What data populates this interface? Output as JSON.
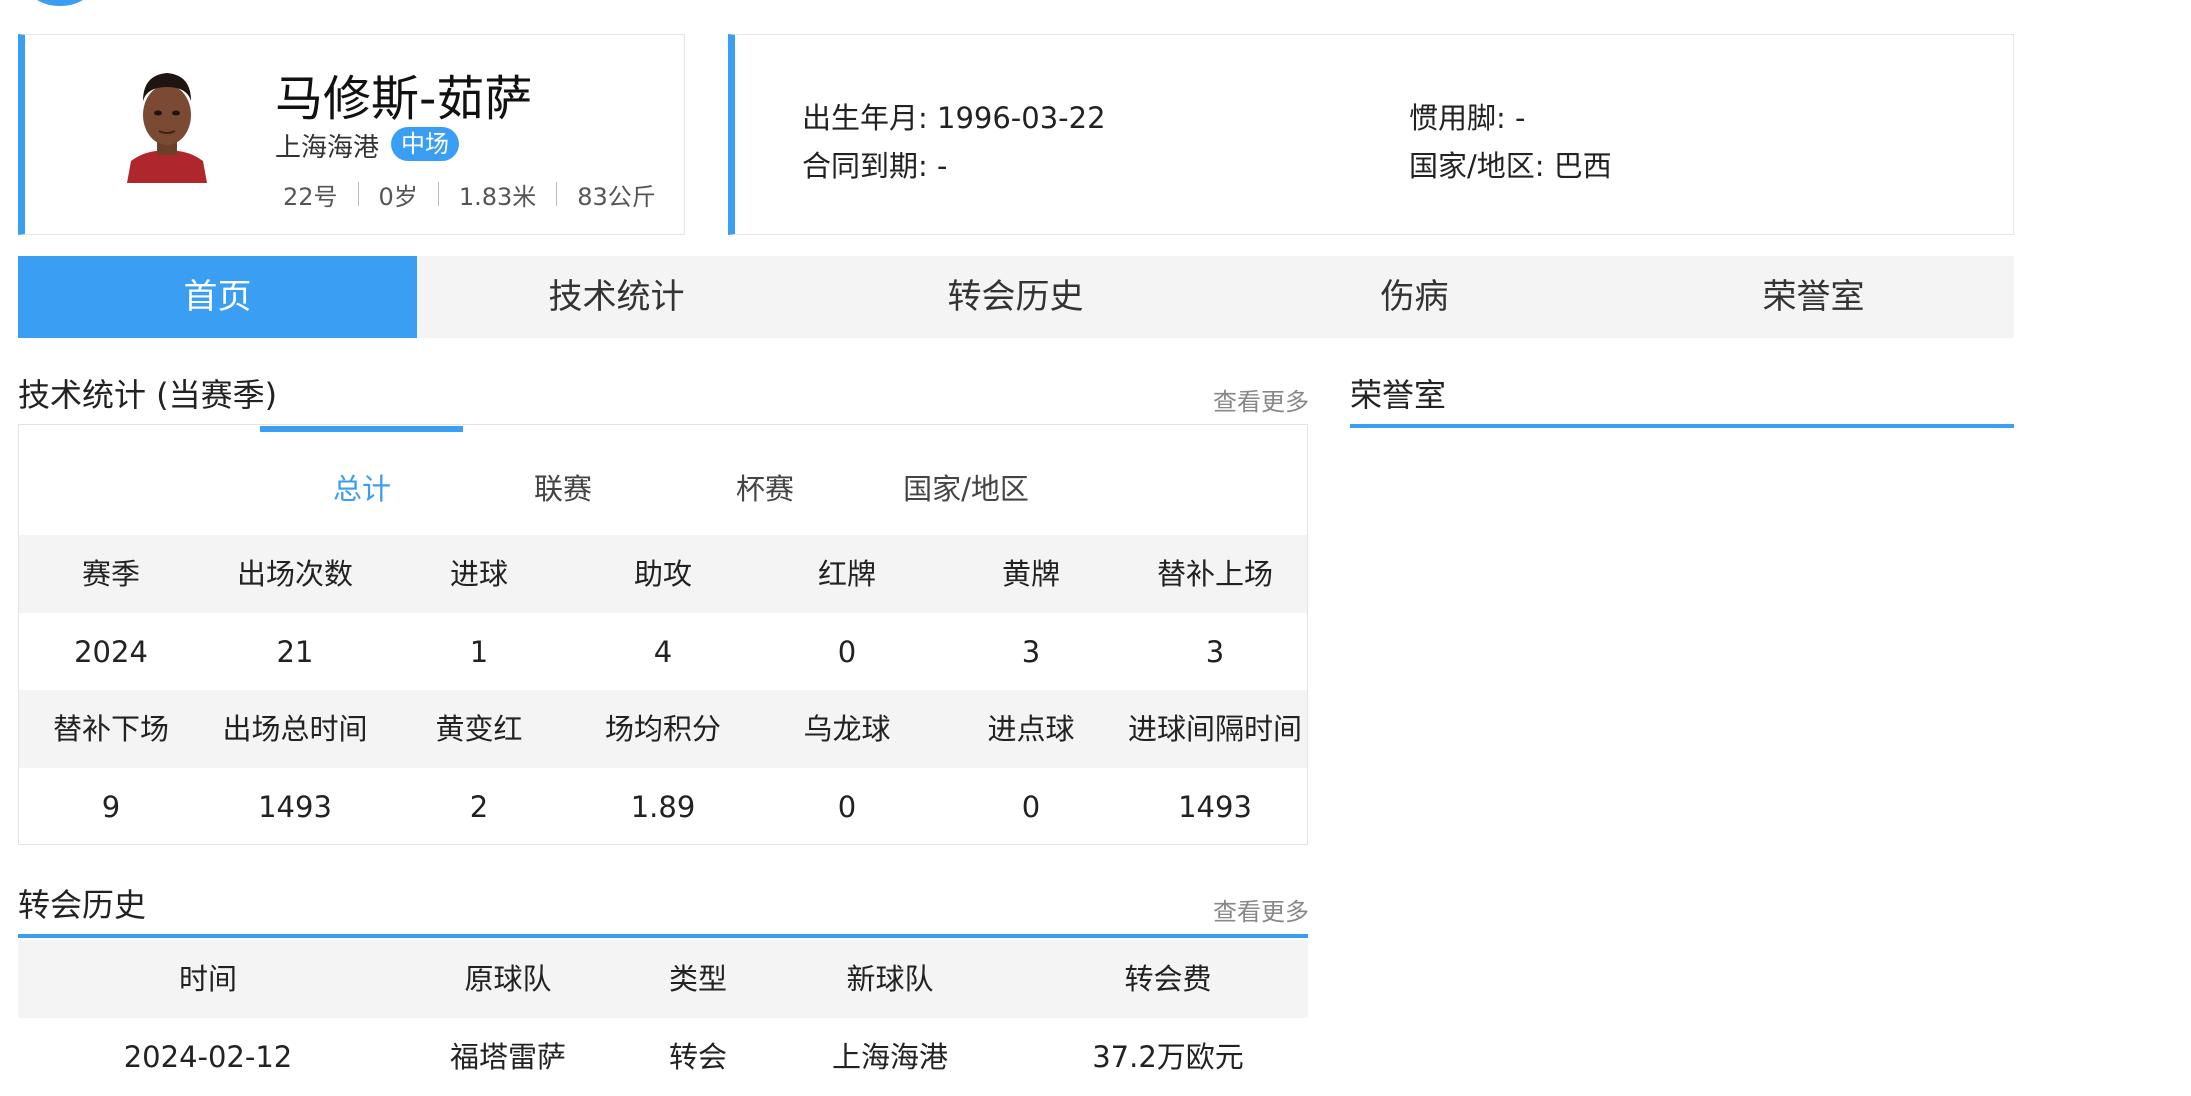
{
  "player": {
    "name": "马修斯-茹萨",
    "team": "上海海港",
    "position": "中场",
    "number": "22号",
    "age": "0岁",
    "height": "1.83米",
    "weight": "83公斤"
  },
  "info": {
    "birth": "出生年月: 1996-03-22",
    "foot": "惯用脚: -",
    "contract": "合同到期: -",
    "nation": "国家/地区: 巴西"
  },
  "nav": [
    "首页",
    "技术统计",
    "转会历史",
    "伤病",
    "荣誉室"
  ],
  "stats": {
    "title": "技术统计 (当赛季)",
    "more": "查看更多",
    "subtabs": [
      "总计",
      "联赛",
      "杯赛",
      "国家/地区"
    ],
    "head1": [
      "赛季",
      "出场次数",
      "进球",
      "助攻",
      "红牌",
      "黄牌",
      "替补上场"
    ],
    "row1": [
      "2024",
      "21",
      "1",
      "4",
      "0",
      "3",
      "3"
    ],
    "head2": [
      "替补下场",
      "出场总时间",
      "黄变红",
      "场均积分",
      "乌龙球",
      "进点球",
      "进球间隔时间"
    ],
    "row2": [
      "9",
      "1493",
      "2",
      "1.89",
      "0",
      "0",
      "1493"
    ]
  },
  "honors": {
    "title": "荣誉室"
  },
  "transfers": {
    "title": "转会历史",
    "more": "查看更多",
    "headers": [
      "时间",
      "原球队",
      "类型",
      "新球队",
      "转会费"
    ],
    "rows": [
      [
        "2024-02-12",
        "福塔雷萨",
        "转会",
        "上海海港",
        "37.2万欧元"
      ]
    ]
  },
  "colors": {
    "accent": "#3a9ff3",
    "header_bg": "#f4f4f4"
  }
}
